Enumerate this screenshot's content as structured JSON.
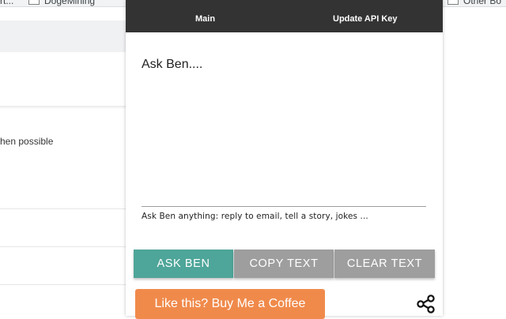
{
  "background_page": {
    "bookmarks": [
      {
        "label": "rt..."
      },
      {
        "label": "DogeMining"
      }
    ],
    "other_bookmarks": "Other Bo",
    "visible_text": "hen possible"
  },
  "popup": {
    "nav": {
      "tabs": [
        {
          "label": "Main"
        },
        {
          "label": "Update API Key"
        }
      ]
    },
    "question_input": {
      "placeholder": "Ask Ben....",
      "value": ""
    },
    "helper_text": "Ask Ben anything: reply to email, tell a story, jokes ...",
    "buttons": {
      "ask": "ASK BEN",
      "copy": "COPY TEXT",
      "clear": "CLEAR TEXT"
    },
    "coffee_button": "Like this? Buy Me a Coffee",
    "share_icon": "share-icon"
  },
  "colors": {
    "navbar": "#333333",
    "ask_button": "#4ea599",
    "secondary_button": "#9e9e9e",
    "coffee_button": "#f08a4b"
  }
}
